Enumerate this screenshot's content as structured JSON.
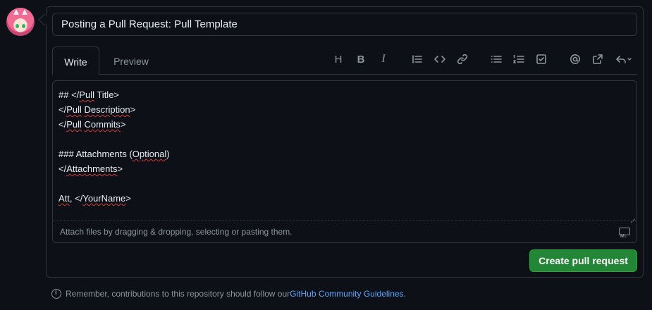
{
  "title_input": {
    "value": "Posting a Pull Request: Pull Template"
  },
  "tabs": {
    "write": "Write",
    "preview": "Preview"
  },
  "toolbar": {
    "heading": "H",
    "bold": "B",
    "italic": "I"
  },
  "editor": {
    "lines": [
      {
        "pre": "## </",
        "sp": "Pull",
        "mid": " Title>",
        "sp2": "",
        "post": ""
      },
      {
        "pre": "</",
        "sp": "Pull",
        "mid": " ",
        "sp2": "Description",
        "post": ">"
      },
      {
        "pre": "</",
        "sp": "Pull",
        "mid": " ",
        "sp2": "Commits",
        "post": ">"
      },
      {
        "pre": "",
        "sp": "",
        "mid": "",
        "sp2": "",
        "post": ""
      },
      {
        "pre": "### Attachments (",
        "sp": "Optional",
        "mid": ")",
        "sp2": "",
        "post": ""
      },
      {
        "pre": "</",
        "sp": "Attachments",
        "mid": ">",
        "sp2": "",
        "post": ""
      },
      {
        "pre": "",
        "sp": "",
        "mid": "",
        "sp2": "",
        "post": ""
      },
      {
        "pre": "",
        "sp": "Att",
        "mid": ", </",
        "sp2": "YourName",
        "post": ">"
      }
    ],
    "attach_hint": "Attach files by dragging & dropping, selecting or pasting them."
  },
  "create_button": "Create pull request",
  "footer": {
    "text": "Remember, contributions to this repository should follow our ",
    "link": "GitHub Community Guidelines",
    "suffix": "."
  },
  "colors": {
    "accent": "#238636",
    "link": "#58a6ff",
    "background": "#0d1117",
    "border": "#30363d"
  }
}
